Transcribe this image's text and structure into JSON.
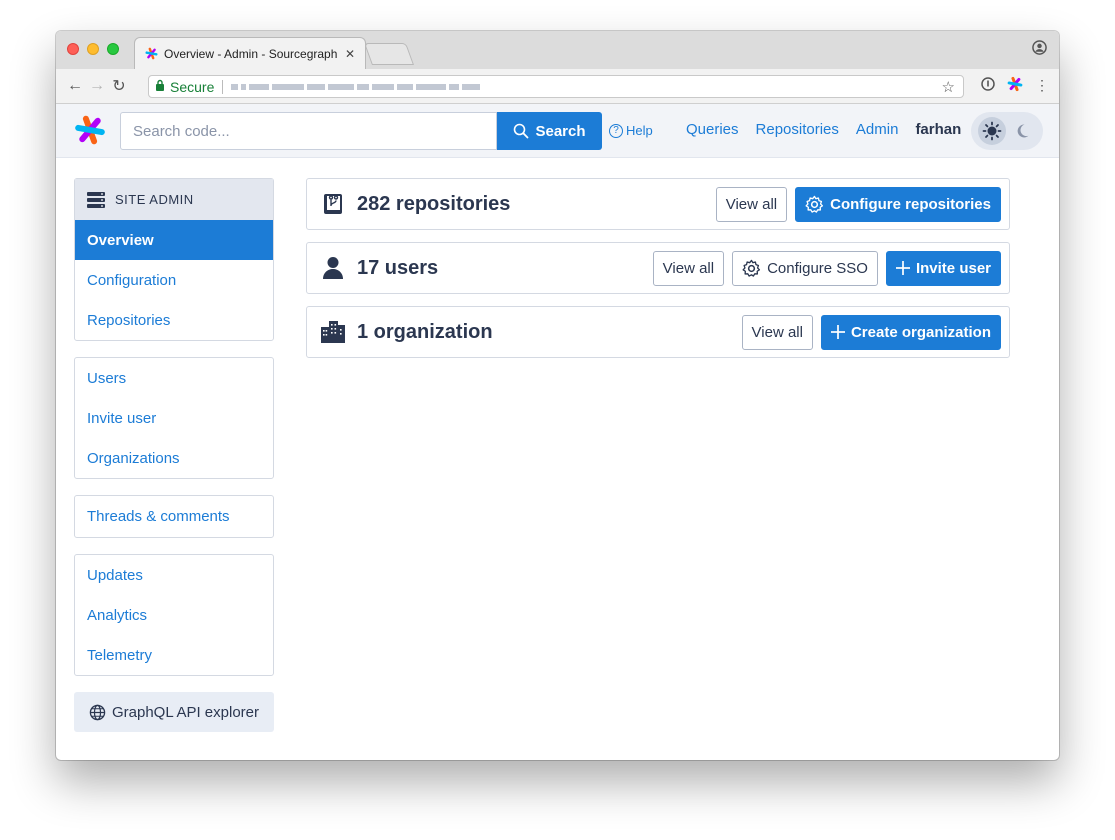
{
  "browser": {
    "tab_title": "Overview - Admin - Sourcegraph",
    "tab_close": "✕",
    "secure_label": "Secure"
  },
  "appnav": {
    "search_placeholder": "Search code...",
    "search_button": "Search",
    "help_label": "Help",
    "links": [
      "Queries",
      "Repositories",
      "Admin"
    ],
    "username": "farhan"
  },
  "sidebar": {
    "header": "SITE ADMIN",
    "group1": [
      "Overview",
      "Configuration",
      "Repositories"
    ],
    "group2": [
      "Users",
      "Invite user",
      "Organizations"
    ],
    "group3": [
      "Threads & comments"
    ],
    "group4": [
      "Updates",
      "Analytics",
      "Telemetry"
    ],
    "graphql_label": "GraphQL API explorer"
  },
  "cards": {
    "repos": {
      "title": "282 repositories",
      "view_all": "View all",
      "action": "Configure repositories"
    },
    "users": {
      "title": "17 users",
      "view_all": "View all",
      "sso": "Configure SSO",
      "action": "Invite user"
    },
    "orgs": {
      "title": "1 organization",
      "view_all": "View all",
      "action": "Create organization"
    }
  },
  "colors": {
    "accent": "#1c7cd6",
    "text": "#2b3750",
    "nav_bg": "#f2f4f8",
    "sidebar_header_bg": "#e3e7ef"
  }
}
